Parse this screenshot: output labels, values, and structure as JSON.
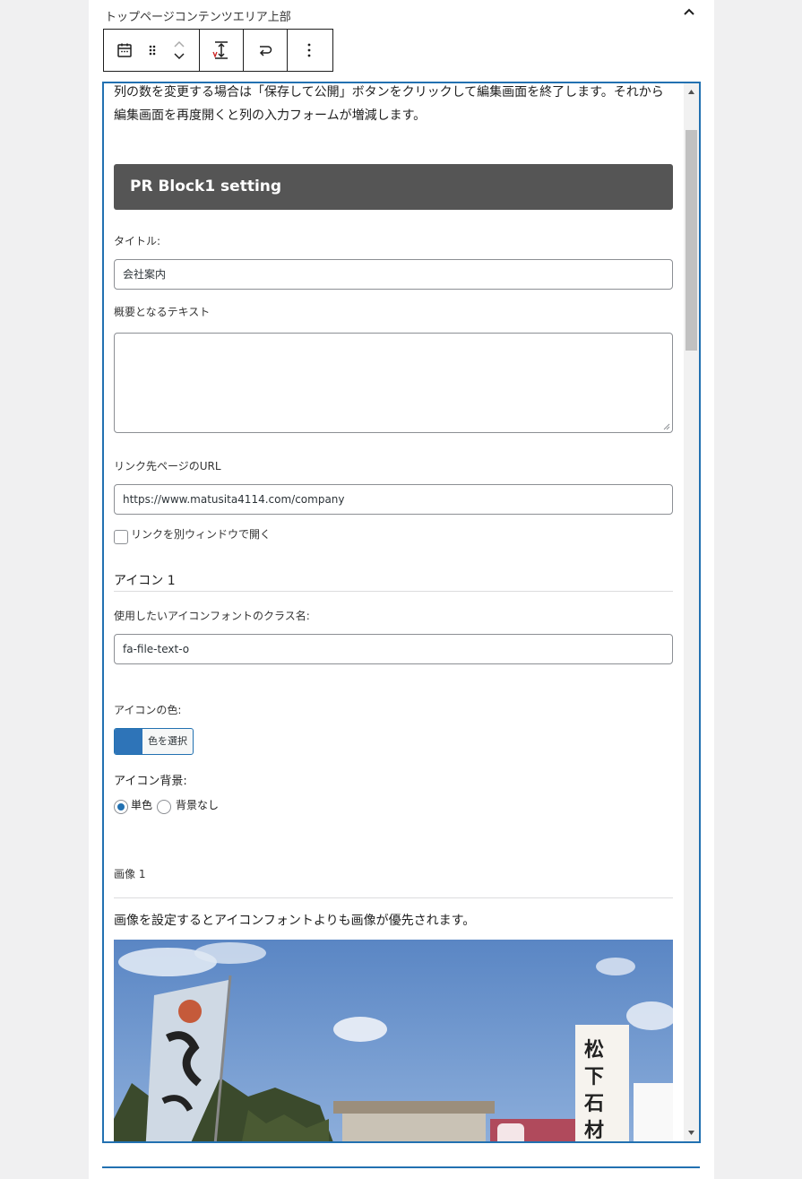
{
  "panel": {
    "title": "トップページコンテンツエリア上部"
  },
  "toolbar": {
    "items": [
      {
        "icon": "calendar-icon"
      },
      {
        "icon": "drag-handle-icon"
      },
      {
        "icon": "move-up-icon"
      },
      {
        "icon": "move-down-icon"
      },
      {
        "icon": "spacing-icon"
      },
      {
        "icon": "transform-icon"
      },
      {
        "icon": "more-options-icon"
      }
    ]
  },
  "editor": {
    "intro_line1": "列の数を変更する場合は「保存して公開」ボタンをクリックして編集画面を終了します。それから",
    "intro_line2": "編集画面を再度開くと列の入力フォームが増減します。",
    "block_heading": "PR Block1 setting",
    "title_label": "タイトル:",
    "title_value": "会社案内",
    "summary_label": "概要となるテキスト",
    "summary_value": "",
    "link_label": "リンク先ページのURL",
    "link_value": "https://www.matusita4114.com/company",
    "new_window_label": "リンクを別ウィンドウで開く",
    "icon_section": "アイコン 1",
    "icon_class_label": "使用したいアイコンフォントのクラス名:",
    "icon_class_value": "fa-file-text-o",
    "icon_color_label": "アイコンの色:",
    "color_button_label": "色を選択",
    "icon_color": "#2e74b8",
    "icon_bg_label": "アイコン背景:",
    "bg_options": [
      {
        "label": "単色",
        "checked": true
      },
      {
        "label": "背景なし",
        "checked": false
      }
    ],
    "image_section": "画像 1",
    "image_note": "画像を設定するとアイコンフォントよりも画像が優先されます。"
  },
  "colors": {
    "accent": "#2271b1",
    "heading_bg": "#555555"
  }
}
